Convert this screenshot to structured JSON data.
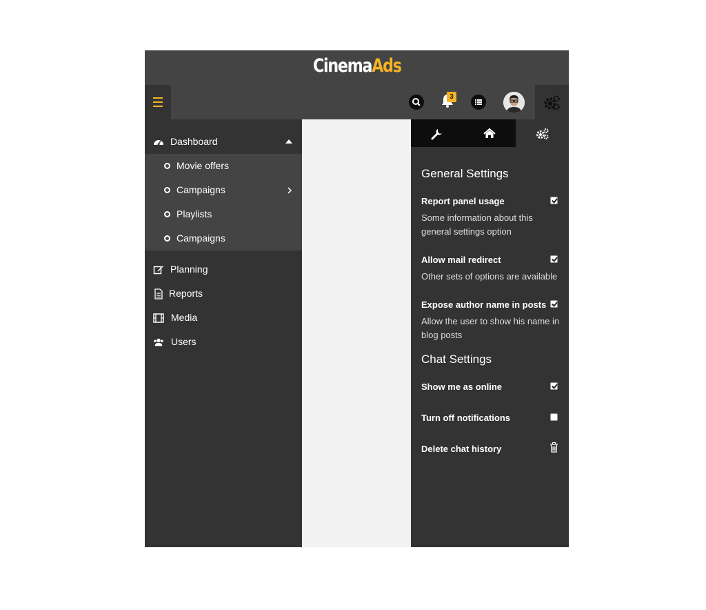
{
  "brand": {
    "name_part1": "Cinema",
    "name_part2": "Ads",
    "accent": "#f5b324"
  },
  "header": {
    "icons": [
      "menu-icon",
      "search-icon",
      "bell-icon",
      "list-icon",
      "avatar",
      "gears-icon"
    ],
    "notification_count": "3"
  },
  "sidebar": {
    "dashboard": {
      "label": "Dashboard",
      "icon": "dashboard-icon"
    },
    "submenu": [
      {
        "label": "Movie offers"
      },
      {
        "label": "Campaigns"
      },
      {
        "label": "Playlists"
      },
      {
        "label": "Campaigns"
      }
    ],
    "items": [
      {
        "label": "Planning",
        "icon": "edit-icon"
      },
      {
        "label": "Reports",
        "icon": "document-icon"
      },
      {
        "label": "Media",
        "icon": "film-icon"
      },
      {
        "label": "Users",
        "icon": "users-icon"
      }
    ]
  },
  "settings": {
    "tabs": [
      "wrench-icon",
      "home-icon",
      "gears-icon"
    ],
    "general": {
      "title": "General Settings",
      "options": [
        {
          "label": "Report panel usage",
          "desc": "Some information about this general settings option",
          "checked": true
        },
        {
          "label": "Allow mail redirect",
          "desc": "Other sets of options are available",
          "checked": true
        },
        {
          "label": "Expose author name in posts",
          "desc": "Allow the user to show his name in blog posts",
          "checked": true
        }
      ]
    },
    "chat": {
      "title": "Chat Settings",
      "options": [
        {
          "label": "Show me as online",
          "checked": true
        },
        {
          "label": "Turn off notifications",
          "checked": false
        },
        {
          "label": "Delete chat history",
          "icon": "trash-icon"
        }
      ]
    }
  }
}
